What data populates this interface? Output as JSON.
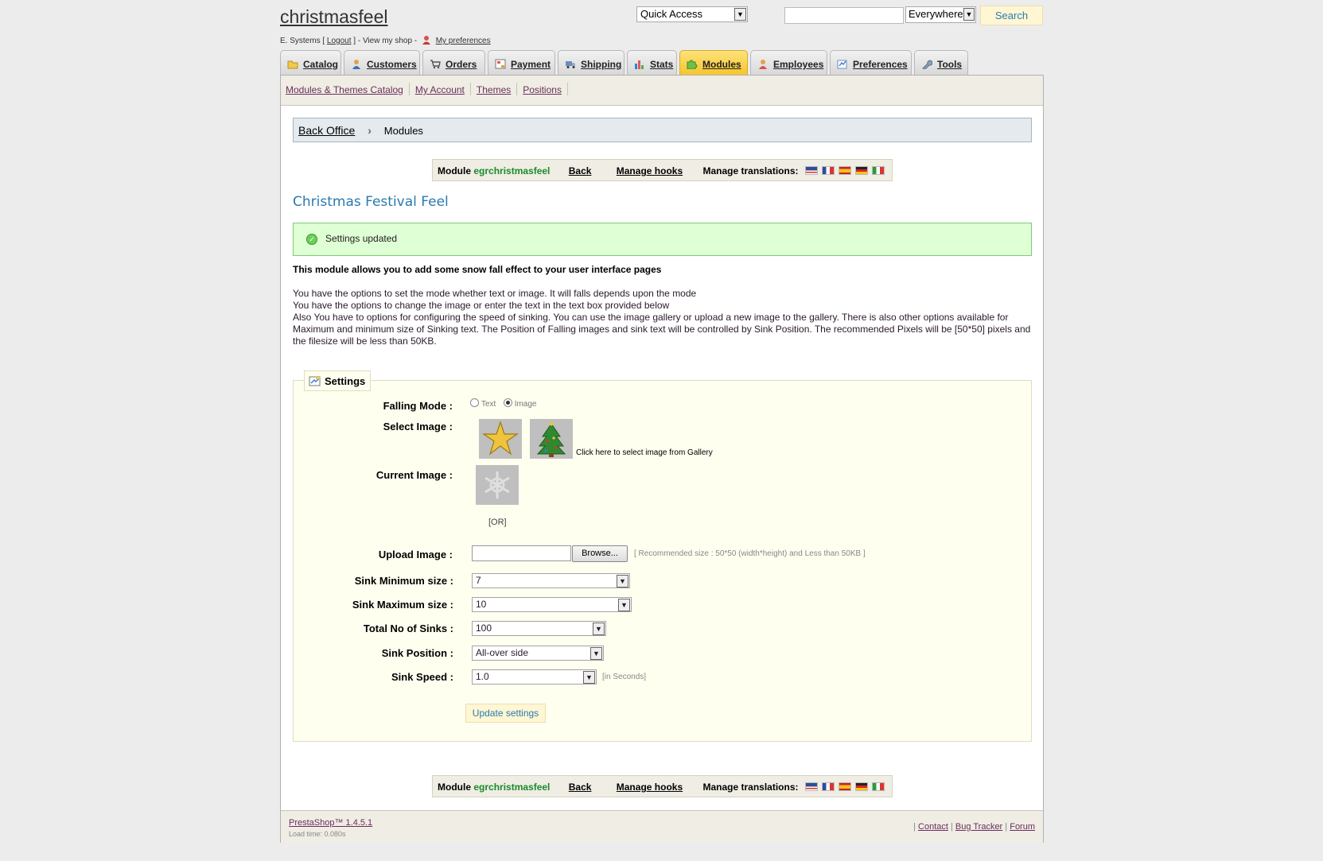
{
  "header": {
    "shop_name": "christmasfeel",
    "user_prefix": "E. Systems [",
    "logout": "Logout",
    "user_mid": "] - View my shop -",
    "my_preferences": "My preferences",
    "quick_access": "Quick Access",
    "search_value": "",
    "search_scope": "Everywhere",
    "search_button": "Search"
  },
  "tabs": [
    {
      "label": "Catalog",
      "icon": "folder-icon"
    },
    {
      "label": "Customers",
      "icon": "user-icon"
    },
    {
      "label": "Orders",
      "icon": "cart-icon"
    },
    {
      "label": "Payment",
      "icon": "payment-icon"
    },
    {
      "label": "Shipping",
      "icon": "truck-icon"
    },
    {
      "label": "Stats",
      "icon": "bar-chart-icon"
    },
    {
      "label": "Modules",
      "icon": "puzzle-icon",
      "active": true
    },
    {
      "label": "Employees",
      "icon": "employee-icon"
    },
    {
      "label": "Preferences",
      "icon": "preferences-icon"
    },
    {
      "label": "Tools",
      "icon": "wrench-icon"
    }
  ],
  "subnav": [
    "Modules & Themes Catalog",
    "My Account",
    "Themes",
    "Positions"
  ],
  "breadcrumb": {
    "root": "Back Office",
    "current": "Modules"
  },
  "module_bar": {
    "module_word": "Module",
    "module_name": "egrchristmasfeel",
    "back": "Back",
    "manage_hooks": "Manage hooks",
    "manage_translations": "Manage translations:",
    "flags": [
      "en",
      "fr",
      "es",
      "de",
      "it"
    ]
  },
  "page_title": "Christmas Festival Feel",
  "confirmation": "Settings updated",
  "intro": {
    "bold": "This module allows you to add some snow fall effect to your user interface pages",
    "line1": "You have the options to set the mode whether text or image. It will falls depends upon the mode",
    "line2": "You have the options to change the image or enter the text in the text box provided below",
    "line3": "Also You have to options for configuring the speed of sinking. You can use the image gallery or upload a new image to the gallery. There is also other options available for Maximum and minimum size of Sinking text. The Position of Falling images and sink text will be controlled by Sink Position. The recommended Pixels will be [50*50] pixels and the filesize will be less than 50KB."
  },
  "settings": {
    "legend": "Settings",
    "falling_mode_label": "Falling Mode :",
    "mode_text": "Text",
    "mode_image": "Image",
    "mode_selected": "Image",
    "select_image_label": "Select Image :",
    "gallery_link": "Click here to select image from Gallery",
    "current_image_label": "Current Image :",
    "or_text": "[OR]",
    "upload_label": "Upload Image :",
    "browse_button": "Browse...",
    "upload_hint": "[ Recommended size : 50*50 (width*height) and Less than 50KB ]",
    "sink_min_label": "Sink Minimum size :",
    "sink_min_value": "7",
    "sink_max_label": "Sink Maximum size :",
    "sink_max_value": "10",
    "total_sinks_label": "Total No of Sinks :",
    "total_sinks_value": "100",
    "sink_position_label": "Sink Position :",
    "sink_position_value": "All-over side",
    "sink_speed_label": "Sink Speed :",
    "sink_speed_value": "1.0",
    "sink_speed_hint": "[in Seconds]",
    "update_button": "Update settings"
  },
  "footer": {
    "version": "PrestaShop™ 1.4.5.1",
    "load_time": "Load time: 0.080s",
    "sep": "|",
    "links": [
      "Contact",
      "Bug Tracker",
      "Forum"
    ]
  },
  "colors": {
    "accent_blue": "#2a7ab0",
    "module_green": "#1a8a2a",
    "active_tab": "#f7c52c",
    "success_bg": "#dfffd5"
  }
}
